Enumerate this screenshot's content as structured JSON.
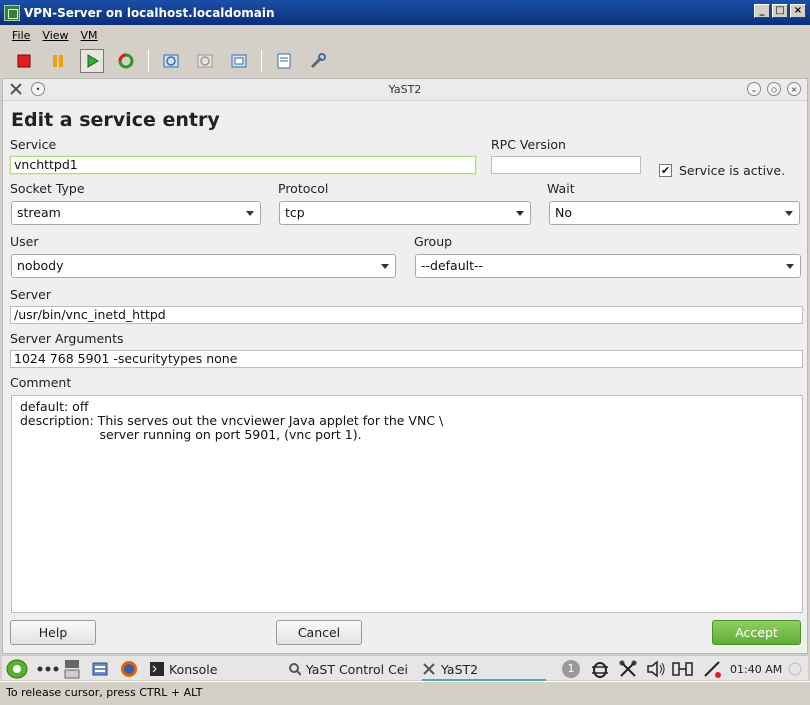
{
  "vm_window": {
    "title": "VPN-Server on localhost.localdomain",
    "menu": [
      "File",
      "View",
      "VM"
    ],
    "toolbar_icons": [
      "stop-icon",
      "pause-icon",
      "play-icon",
      "reset-icon",
      "snapshot-icon",
      "revert-snapshot-icon",
      "snapshot-manager-icon",
      "settings-icon",
      "tools-icon"
    ]
  },
  "yast": {
    "window_title": "YaST2",
    "heading": "Edit a service entry",
    "service_label": "Service",
    "service_value": "vnchttpd1",
    "rpc_version_label": "RPC Version",
    "rpc_version_value": "",
    "service_active_label": "Service is active.",
    "service_active_checked": "✔",
    "socket_type_label": "Socket Type",
    "socket_type_value": "stream",
    "protocol_label": "Protocol",
    "protocol_value": "tcp",
    "wait_label": "Wait",
    "wait_value": "No",
    "user_label": "User",
    "user_value": "nobody",
    "group_label": "Group",
    "group_value": "--default--",
    "server_label": "Server",
    "server_value": "/usr/bin/vnc_inetd_httpd",
    "server_args_label": "Server Arguments",
    "server_args_value": "1024 768 5901 -securitytypes none",
    "comment_label": "Comment",
    "comment_lines": [
      "default: off",
      "description: This serves out the vncviewer Java applet for the VNC \\",
      "                    server running on port 5901, (vnc port 1)."
    ],
    "help_button": "Help",
    "cancel_button": "Cancel",
    "accept_button": "Accept"
  },
  "taskbar": {
    "konsole": "Konsole",
    "yast_control": "YaST Control Cei",
    "yast2": "YaST2",
    "desktop_number": "1",
    "clock": "01:40 AM"
  },
  "statusbar": "To release cursor, press CTRL + ALT",
  "colors": {
    "accept": "#5fae35",
    "vm_title": "#0a2f7a"
  }
}
